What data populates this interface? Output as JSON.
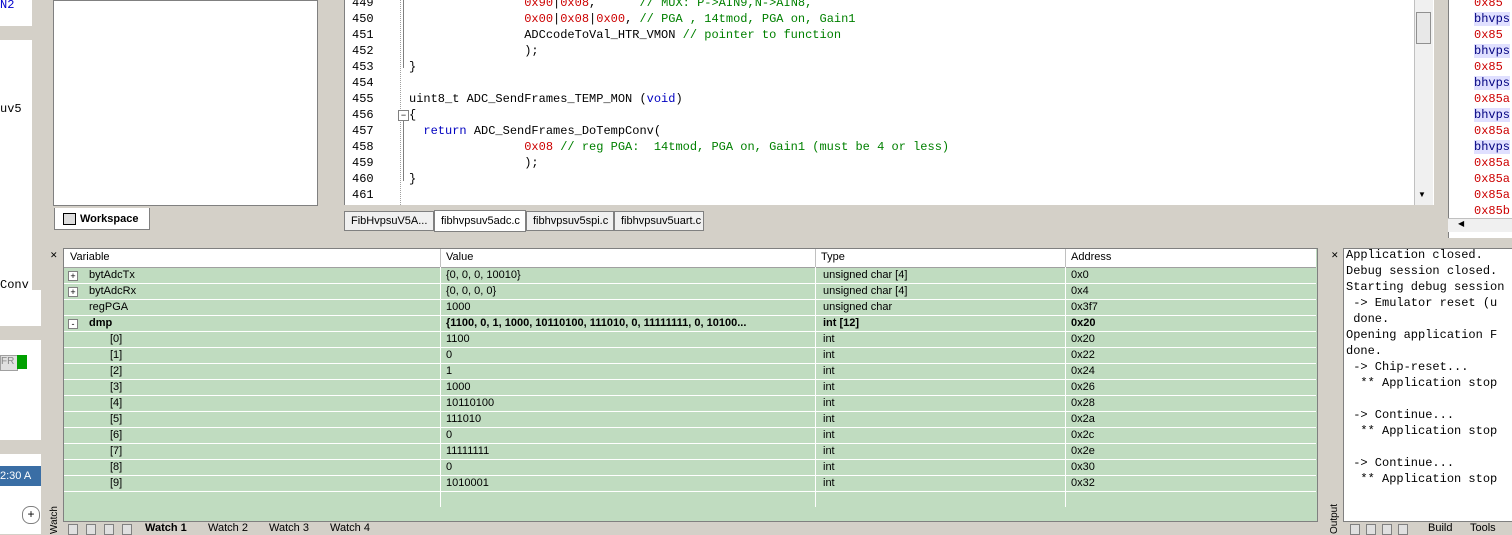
{
  "left_strip": {
    "labels": [
      "N2",
      "uv5",
      "Conv",
      "FR"
    ],
    "time": "2:30 A"
  },
  "workspace": {
    "tab_label": "Workspace"
  },
  "editor": {
    "lines": [
      {
        "n": "449",
        "parts": [
          {
            "t": "                ",
            "c": ""
          },
          {
            "t": "0x90",
            "c": "num"
          },
          {
            "t": "|",
            "c": ""
          },
          {
            "t": "0x08",
            "c": "num"
          },
          {
            "t": ",      ",
            "c": ""
          },
          {
            "t": "// MUX: P->AIN9,N->AIN8,",
            "c": "cmt"
          }
        ]
      },
      {
        "n": "450",
        "parts": [
          {
            "t": "                ",
            "c": ""
          },
          {
            "t": "0x00",
            "c": "num"
          },
          {
            "t": "|",
            "c": ""
          },
          {
            "t": "0x08",
            "c": "num"
          },
          {
            "t": "|",
            "c": ""
          },
          {
            "t": "0x00",
            "c": "num"
          },
          {
            "t": ", ",
            "c": ""
          },
          {
            "t": "// PGA , 14tmod, PGA on, Gain1",
            "c": "cmt"
          }
        ]
      },
      {
        "n": "451",
        "parts": [
          {
            "t": "                ADCcodeToVal_HTR_VMON ",
            "c": ""
          },
          {
            "t": "// pointer to function",
            "c": "cmt"
          }
        ]
      },
      {
        "n": "452",
        "parts": [
          {
            "t": "                );",
            "c": ""
          }
        ]
      },
      {
        "n": "453",
        "parts": [
          {
            "t": "}",
            "c": ""
          }
        ]
      },
      {
        "n": "454",
        "parts": [
          {
            "t": "",
            "c": ""
          }
        ]
      },
      {
        "n": "455",
        "parts": [
          {
            "t": "uint8_t ADC_SendFrames_TEMP_MON (",
            "c": ""
          },
          {
            "t": "void",
            "c": "kw"
          },
          {
            "t": ")",
            "c": ""
          }
        ]
      },
      {
        "n": "456",
        "parts": [
          {
            "t": "{",
            "c": ""
          }
        ]
      },
      {
        "n": "457",
        "parts": [
          {
            "t": "  ",
            "c": ""
          },
          {
            "t": "return",
            "c": "kw"
          },
          {
            "t": " ADC_SendFrames_DoTempConv(",
            "c": ""
          }
        ]
      },
      {
        "n": "458",
        "parts": [
          {
            "t": "                ",
            "c": ""
          },
          {
            "t": "0x08",
            "c": "num"
          },
          {
            "t": " ",
            "c": ""
          },
          {
            "t": "// reg PGA:  14tmod, PGA on, Gain1 (must be 4 or less)",
            "c": "cmt"
          }
        ]
      },
      {
        "n": "459",
        "parts": [
          {
            "t": "                );",
            "c": ""
          }
        ]
      },
      {
        "n": "460",
        "parts": [
          {
            "t": "}",
            "c": ""
          }
        ]
      },
      {
        "n": "461",
        "parts": [
          {
            "t": "",
            "c": ""
          }
        ]
      }
    ]
  },
  "file_tabs": [
    "FibHvpsuV5A...",
    "fibhvpsuv5adc.c",
    "fibhvpsuv5spi.c",
    "fibhvpsuv5uart.c"
  ],
  "active_file_tab": 1,
  "disassembly": [
    {
      "t": "0x85",
      "k": "hex"
    },
    {
      "t": "bhvps",
      "k": "sym"
    },
    {
      "t": "0x85",
      "k": "hex"
    },
    {
      "t": "bhvps",
      "k": "sym"
    },
    {
      "t": "0x85",
      "k": "hex"
    },
    {
      "t": "bhvps",
      "k": "sym"
    },
    {
      "t": "0x85a",
      "k": "hex"
    },
    {
      "t": "bhvps",
      "k": "sym"
    },
    {
      "t": "0x85a",
      "k": "hex"
    },
    {
      "t": "bhvps",
      "k": "sym"
    },
    {
      "t": "0x85a",
      "k": "hex"
    },
    {
      "t": "0x85a",
      "k": "hex"
    },
    {
      "t": "0x85a",
      "k": "hex"
    },
    {
      "t": "0x85b",
      "k": "hex"
    }
  ],
  "watch": {
    "headers": [
      "Variable",
      "Value",
      "Type",
      "Address"
    ],
    "rows": [
      {
        "name": "bytAdcTx",
        "value": "{0, 0, 0, 10010}",
        "type": "unsigned char [4]",
        "address": "0x0",
        "expander": "+",
        "indent": 0,
        "bold": false
      },
      {
        "name": "bytAdcRx",
        "value": "{0, 0, 0, 0}",
        "type": "unsigned char [4]",
        "address": "0x4",
        "expander": "+",
        "indent": 0,
        "bold": false
      },
      {
        "name": "regPGA",
        "value": "1000",
        "type": "unsigned char",
        "address": "0x3f7",
        "expander": "",
        "indent": 0,
        "bold": false
      },
      {
        "name": "dmp",
        "value": "{1100, 0, 1, 1000, 10110100, 111010, 0, 11111111, 0, 10100...",
        "type": "int [12]",
        "address": "0x20",
        "expander": "-",
        "indent": 0,
        "bold": true
      },
      {
        "name": "[0]",
        "value": "1100",
        "type": "int",
        "address": "0x20",
        "expander": "",
        "indent": 1,
        "bold": false
      },
      {
        "name": "[1]",
        "value": "0",
        "type": "int",
        "address": "0x22",
        "expander": "",
        "indent": 1,
        "bold": false
      },
      {
        "name": "[2]",
        "value": "1",
        "type": "int",
        "address": "0x24",
        "expander": "",
        "indent": 1,
        "bold": false
      },
      {
        "name": "[3]",
        "value": "1000",
        "type": "int",
        "address": "0x26",
        "expander": "",
        "indent": 1,
        "bold": false
      },
      {
        "name": "[4]",
        "value": "10110100",
        "type": "int",
        "address": "0x28",
        "expander": "",
        "indent": 1,
        "bold": false
      },
      {
        "name": "[5]",
        "value": "111010",
        "type": "int",
        "address": "0x2a",
        "expander": "",
        "indent": 1,
        "bold": false
      },
      {
        "name": "[6]",
        "value": "0",
        "type": "int",
        "address": "0x2c",
        "expander": "",
        "indent": 1,
        "bold": false
      },
      {
        "name": "[7]",
        "value": "11111111",
        "type": "int",
        "address": "0x2e",
        "expander": "",
        "indent": 1,
        "bold": false
      },
      {
        "name": "[8]",
        "value": "0",
        "type": "int",
        "address": "0x30",
        "expander": "",
        "indent": 1,
        "bold": false
      },
      {
        "name": "[9]",
        "value": "1010001",
        "type": "int",
        "address": "0x32",
        "expander": "",
        "indent": 1,
        "bold": false
      }
    ],
    "tabs": [
      "Watch 1",
      "Watch 2",
      "Watch 3",
      "Watch 4"
    ],
    "side_label": "Watch"
  },
  "output": {
    "lines": [
      "Application closed.",
      "Debug session closed.",
      "Starting debug session",
      " -> Emulator reset (u",
      " done.",
      "Opening application F",
      "done.",
      " -> Chip-reset...",
      "  ** Application stop",
      "",
      " -> Continue...",
      "  ** Application stop",
      "",
      " -> Continue...",
      "  ** Application stop"
    ],
    "tabs": [
      "Build",
      "Tools"
    ],
    "side_label": "Output"
  }
}
